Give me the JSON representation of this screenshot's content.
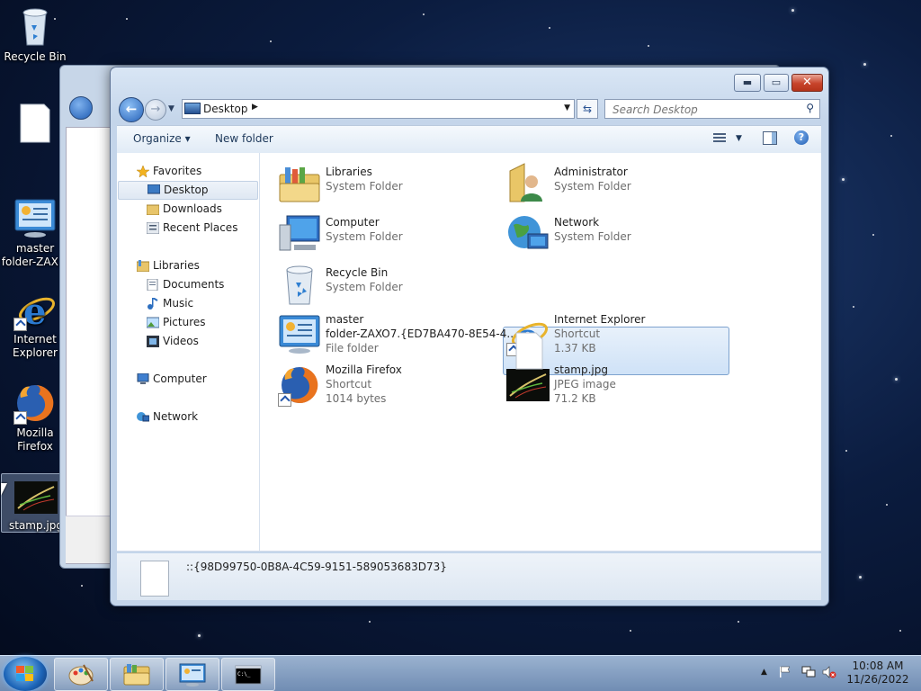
{
  "desktop": {
    "icons": [
      {
        "label": "Recycle Bin"
      },
      {
        "label": ""
      },
      {
        "label": "master folder-ZAX..."
      },
      {
        "label": "Internet Explorer"
      },
      {
        "label": "Mozilla Firefox"
      },
      {
        "label": "stamp.jpg"
      }
    ]
  },
  "window": {
    "controls": {
      "minimize": "▬",
      "maximize": "▭",
      "close": "✕"
    },
    "address": {
      "location": "Desktop",
      "arrow": "▶"
    },
    "search": {
      "placeholder": "Search Desktop"
    },
    "toolbar": {
      "organize": "Organize ▾",
      "new_folder": "New folder"
    },
    "nav": {
      "favorites": "Favorites",
      "desktop": "Desktop",
      "downloads": "Downloads",
      "recent_places": "Recent Places",
      "libraries": "Libraries",
      "documents": "Documents",
      "music": "Music",
      "pictures": "Pictures",
      "videos": "Videos",
      "computer": "Computer",
      "network": "Network"
    },
    "items": [
      {
        "name": "Libraries",
        "line1": "System Folder",
        "line2": ""
      },
      {
        "name": "Administrator",
        "line1": "System Folder",
        "line2": ""
      },
      {
        "name": "Computer",
        "line1": "System Folder",
        "line2": ""
      },
      {
        "name": "Network",
        "line1": "System Folder",
        "line2": ""
      },
      {
        "name": "Recycle Bin",
        "line1": "System Folder",
        "line2": ""
      },
      {
        "name": "",
        "line1": "",
        "line2": ""
      },
      {
        "name": "master",
        "line1": "folder-ZAXO7.{ED7BA470-8E54-4...",
        "line2": "File folder"
      },
      {
        "name": "Internet Explorer",
        "line1": "Shortcut",
        "line2": "1.37 KB"
      },
      {
        "name": "Mozilla Firefox",
        "line1": "Shortcut",
        "line2": "1014 bytes"
      },
      {
        "name": "stamp.jpg",
        "line1": "JPEG image",
        "line2": "71.2 KB"
      }
    ],
    "status_text": "::{98D99750-0B8A-4C59-9151-589053683D73}"
  },
  "taskbar": {
    "clock_time": "10:08 AM",
    "clock_date": "11/26/2022",
    "tray_up": "▲"
  }
}
